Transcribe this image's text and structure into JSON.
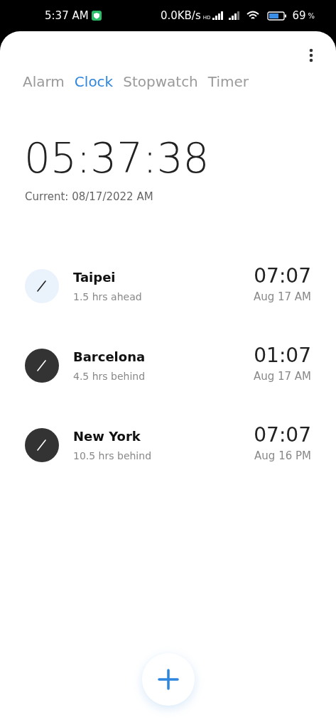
{
  "status_bar": {
    "time": "5:37 AM",
    "speed": "0.0KB/s",
    "hd": "HD",
    "battery": "69",
    "percent": "%"
  },
  "tabs": [
    {
      "label": "Alarm",
      "selected": false
    },
    {
      "label": "Clock",
      "selected": true
    },
    {
      "label": "Stopwatch",
      "selected": false
    },
    {
      "label": "Timer",
      "selected": false
    }
  ],
  "current_time": "05:37:38",
  "current_date": "Current: 08/17/2022 AM",
  "cities": [
    {
      "name": "Taipei",
      "offset": "1.5 hrs ahead",
      "time": "07:07",
      "date": "Aug 17 AM",
      "daytime": true
    },
    {
      "name": "Barcelona",
      "offset": "4.5 hrs behind",
      "time": "01:07",
      "date": "Aug 17 AM",
      "daytime": false
    },
    {
      "name": "New York",
      "offset": "10.5 hrs behind",
      "time": "07:07",
      "date": "Aug 16 PM",
      "daytime": false
    }
  ]
}
